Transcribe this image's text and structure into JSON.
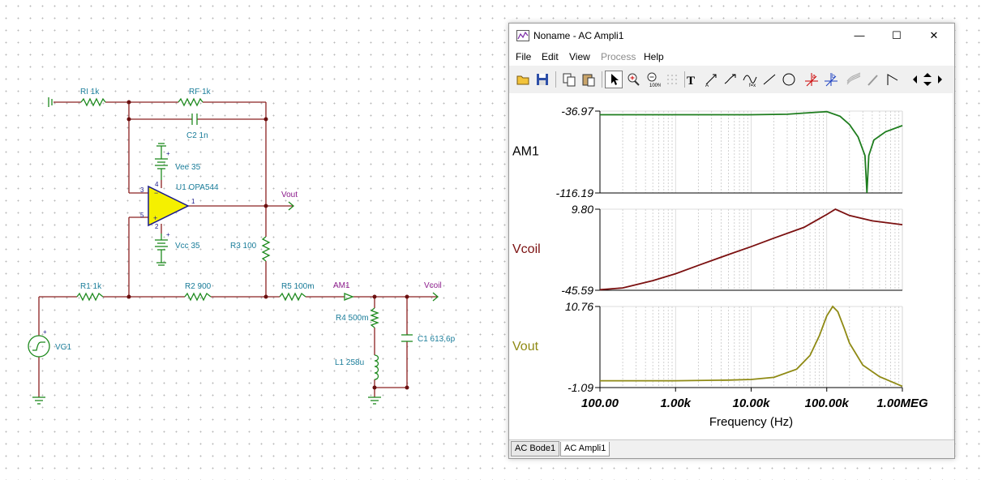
{
  "schematic": {
    "components": {
      "ri": "RI 1k",
      "rf": "RF 1k",
      "c2": "C2 1n",
      "vee": "Vee 35",
      "u1": "U1 OPA544",
      "vcc": "Vcc 35",
      "r3": "R3 100",
      "r1": "R1 1k",
      "r2": "R2 900",
      "r5": "R5 100m",
      "r4": "R4 500m",
      "l1": "L1 258u",
      "c1": "C1 613,6p",
      "vg1": "VG1"
    },
    "nets": {
      "vout": "Vout",
      "am1": "AM1",
      "vcoil": "Vcoil"
    },
    "pins": {
      "p3": "3",
      "p4": "4",
      "p5": "5",
      "p2": "2",
      "p1": "1",
      "plus": "+"
    }
  },
  "window": {
    "title": "Noname - AC Ampli1",
    "controls": {
      "minimize": "—",
      "maximize": "☐",
      "close": "✕"
    },
    "menu": [
      {
        "label": "File",
        "enabled": true
      },
      {
        "label": "Edit",
        "enabled": true
      },
      {
        "label": "View",
        "enabled": true
      },
      {
        "label": "Process",
        "enabled": false
      },
      {
        "label": "Help",
        "enabled": true
      }
    ],
    "toolbar_icons": [
      "open-icon",
      "save-icon",
      "copy-icon",
      "paste-icon",
      "pointer-icon",
      "zoom-in-icon",
      "zoom-100-icon",
      "grid-icon",
      "text-icon",
      "arrow-text-icon",
      "arrow-curve-icon",
      "formula-icon",
      "line-icon",
      "circle-icon",
      "cursor-a-icon",
      "cursor-b-icon",
      "waves-icon",
      "probe-icon",
      "marker-icon",
      "scroll-left-icon",
      "scroll-updown-icon",
      "scroll-right-icon"
    ],
    "tabs": [
      {
        "label": "AC Bode1",
        "active": false
      },
      {
        "label": "AC Ampli1",
        "active": true
      }
    ],
    "colors": {
      "am1": "#1e7d1e",
      "vcoil": "#7b1010",
      "vout": "#8f8a14"
    }
  },
  "chart_data": {
    "type": "line",
    "xscale": "log",
    "xlabel": "Frequency (Hz)",
    "xlim": [
      100,
      1000000
    ],
    "xtick_labels": [
      "100.00",
      "1.00k",
      "10.00k",
      "100.00k",
      "1.00MEG"
    ],
    "panels": [
      {
        "name": "AM1",
        "ylim": [
          -116.19,
          -36.97
        ],
        "ytick_labels": [
          "-36.97",
          "-116.19"
        ],
        "x": [
          100,
          1000,
          10000,
          30000,
          60000,
          100000,
          150000,
          200000,
          260000,
          320000,
          340000,
          360000,
          420000,
          600000,
          1000000
        ],
        "y": [
          -40.5,
          -40.5,
          -40.5,
          -40.0,
          -38.5,
          -37.5,
          -42,
          -50,
          -62,
          -80,
          -116,
          -80,
          -65,
          -57,
          -51
        ]
      },
      {
        "name": "Vcoil",
        "ylim": [
          -45.59,
          9.8
        ],
        "ytick_labels": [
          "9.80",
          "-45.59"
        ],
        "x": [
          100,
          200,
          500,
          1000,
          2000,
          5000,
          10000,
          20000,
          50000,
          100000,
          130000,
          200000,
          400000,
          1000000
        ],
        "y": [
          -45.2,
          -44,
          -39,
          -34.3,
          -28.6,
          -21.2,
          -15.8,
          -10,
          -2.6,
          6.2,
          9.8,
          5.5,
          1.8,
          -0.8
        ]
      },
      {
        "name": "Vout",
        "ylim": [
          -1.09,
          10.76
        ],
        "ytick_labels": [
          "10.76",
          "-1.09"
        ],
        "x": [
          100,
          1000,
          5000,
          10000,
          20000,
          40000,
          60000,
          80000,
          100000,
          120000,
          140000,
          170000,
          200000,
          300000,
          500000,
          1000000
        ],
        "y": [
          -0.1,
          -0.1,
          0.0,
          0.1,
          0.4,
          1.6,
          3.6,
          6.5,
          9.4,
          10.76,
          10.0,
          7.6,
          5.4,
          2.2,
          0.5,
          -0.9
        ]
      }
    ]
  }
}
